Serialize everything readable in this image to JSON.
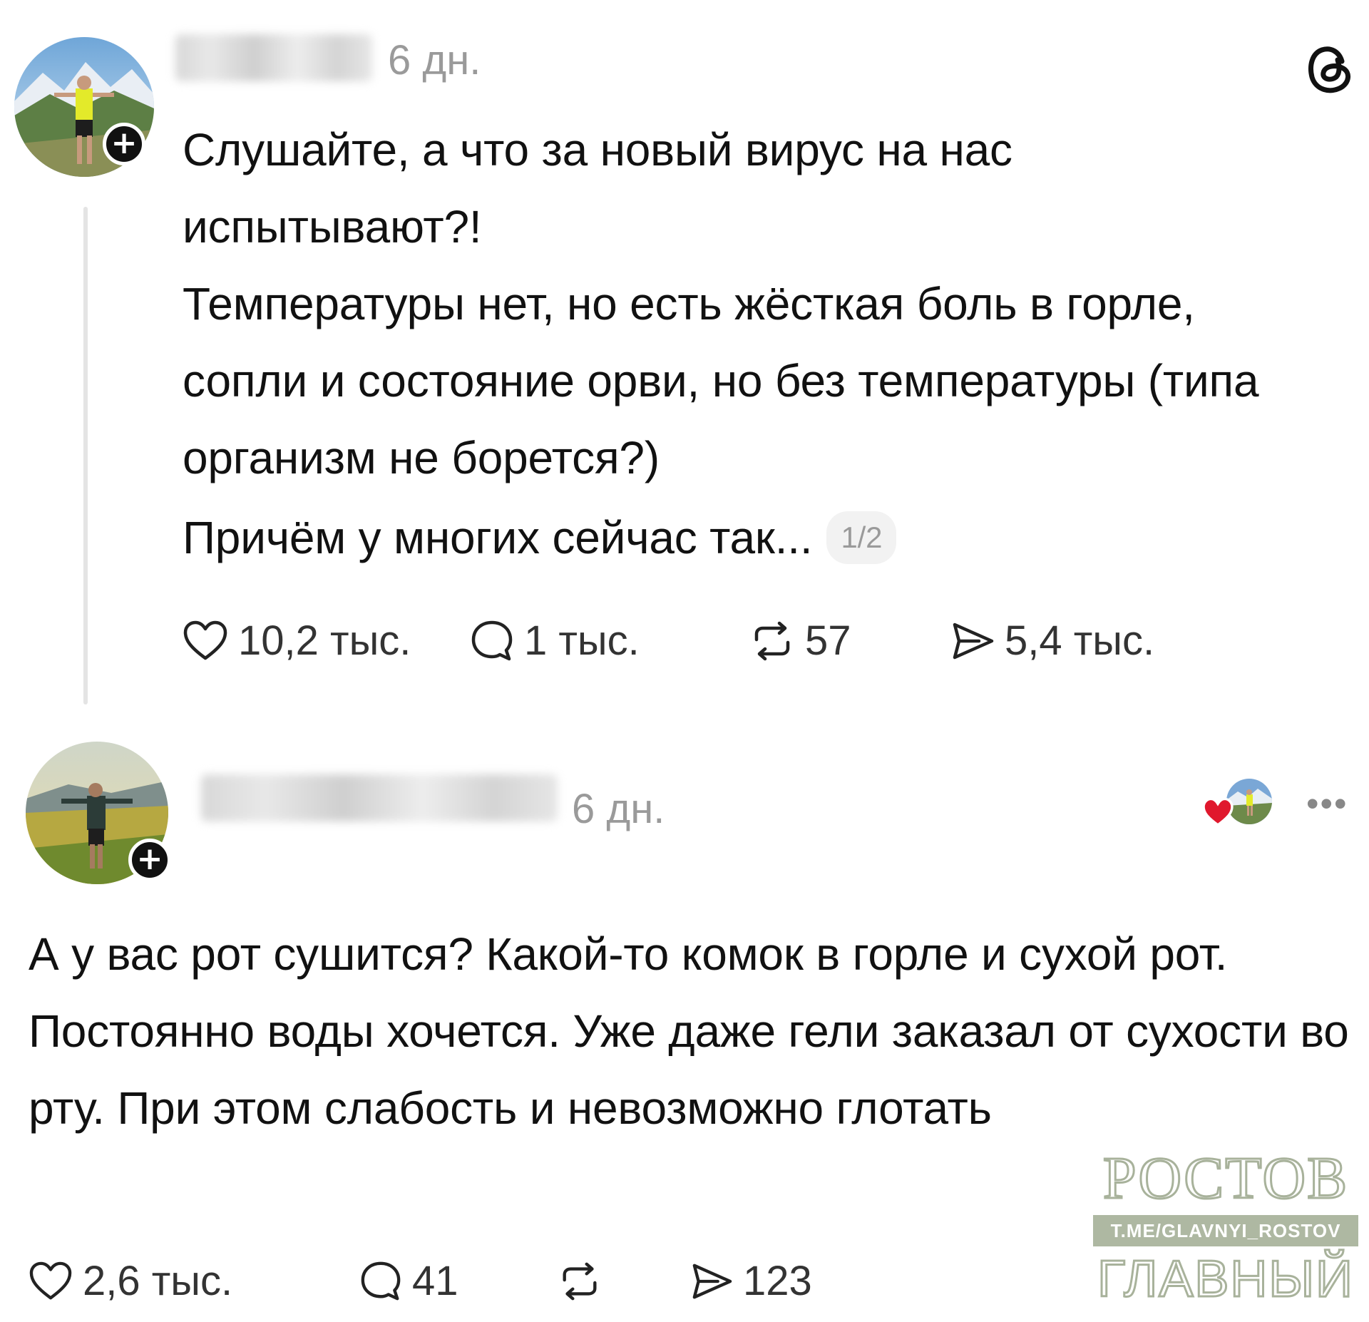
{
  "post1": {
    "timestamp": "6 дн.",
    "paragraphs": [
      "Слушайте, а что за новый вирус на нас испытывают?!",
      "Температуры нет, но есть жёсткая боль в горле, сопли и состояние орви, но без температуры (типа организм не борется?)"
    ],
    "last_line": "Причём у многих сейчас так...",
    "page_indicator": "1/2",
    "likes": "10,2 тыс.",
    "replies": "1 тыс.",
    "reposts": "57",
    "shares": "5,4 тыс.",
    "follow_symbol": "+"
  },
  "post2": {
    "timestamp": "6 дн.",
    "text": "А у вас рот сушится? Какой-то комок в горле и сухой рот. Постоянно воды хочется. Уже даже гели заказал от сухости во рту. При этом слабость и невозможно глотать",
    "likes": "2,6 тыс.",
    "replies": "41",
    "reposts": "",
    "shares": "123",
    "follow_symbol": "+",
    "more_menu": "•••"
  },
  "watermark": {
    "top": "РОСТОВ",
    "middle": "T.ME/GLAVNYI_ROSTOV",
    "bottom": "ГЛАВНЫЙ"
  },
  "icons": {
    "app_logo": "threads-logo-icon",
    "like": "heart-outline-icon",
    "reply": "speech-bubble-icon",
    "repost": "repost-arrows-icon",
    "share": "send-icon",
    "liked_by_author": "red-heart-icon"
  },
  "colors": {
    "text": "#111111",
    "muted": "#9a9a9a",
    "thread_line": "#e4e4e4",
    "heart_red": "#e0182d",
    "watermark": "#a8b29b"
  }
}
